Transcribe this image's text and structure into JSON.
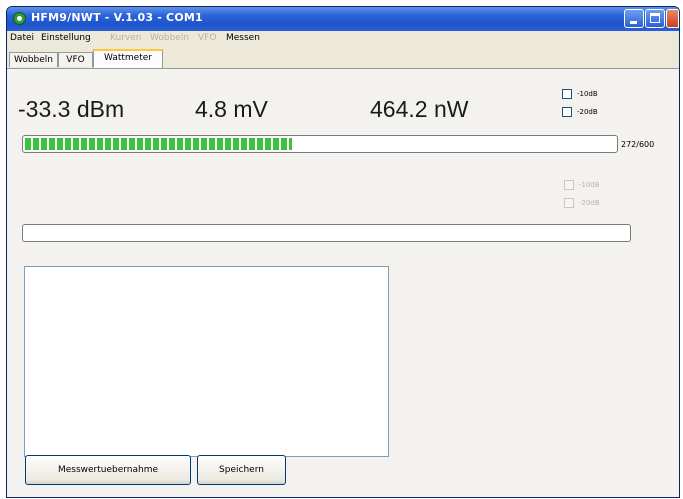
{
  "window": {
    "title": "HFM9/NWT - V.1.03 - COM1"
  },
  "menu": [
    {
      "label": "Datei",
      "enabled": true
    },
    {
      "label": "Einstellung",
      "enabled": true
    },
    {
      "label": "Kurven",
      "enabled": false
    },
    {
      "label": "Wobbeln",
      "enabled": false
    },
    {
      "label": "VFO",
      "enabled": false
    },
    {
      "label": "Messen",
      "enabled": true
    }
  ],
  "tabs": [
    {
      "label": "Wobbeln",
      "active": false
    },
    {
      "label": "VFO",
      "active": false
    },
    {
      "label": "Wattmeter",
      "active": true
    }
  ],
  "channel1": {
    "dbm": "-33.3 dBm",
    "voltage": "4.8 mV",
    "power": "464.2 nW",
    "att_options": [
      {
        "label": "-10dB",
        "checked": false,
        "enabled": true
      },
      {
        "label": "-20dB",
        "checked": false,
        "enabled": true
      }
    ],
    "bar_value": 272,
    "bar_max": 600,
    "bar_text": "272/600"
  },
  "channel2": {
    "att_options": [
      {
        "label": "-10dB",
        "checked": false,
        "enabled": false
      },
      {
        "label": "-20dB",
        "checked": false,
        "enabled": false
      }
    ],
    "bar_value": 0,
    "bar_max": 600
  },
  "actions": {
    "take_reading": "Messwertuebernahme",
    "save": "Speichern"
  },
  "colors": {
    "bar_fill": "#3cc13c",
    "titlebar": "#2b63d8"
  }
}
